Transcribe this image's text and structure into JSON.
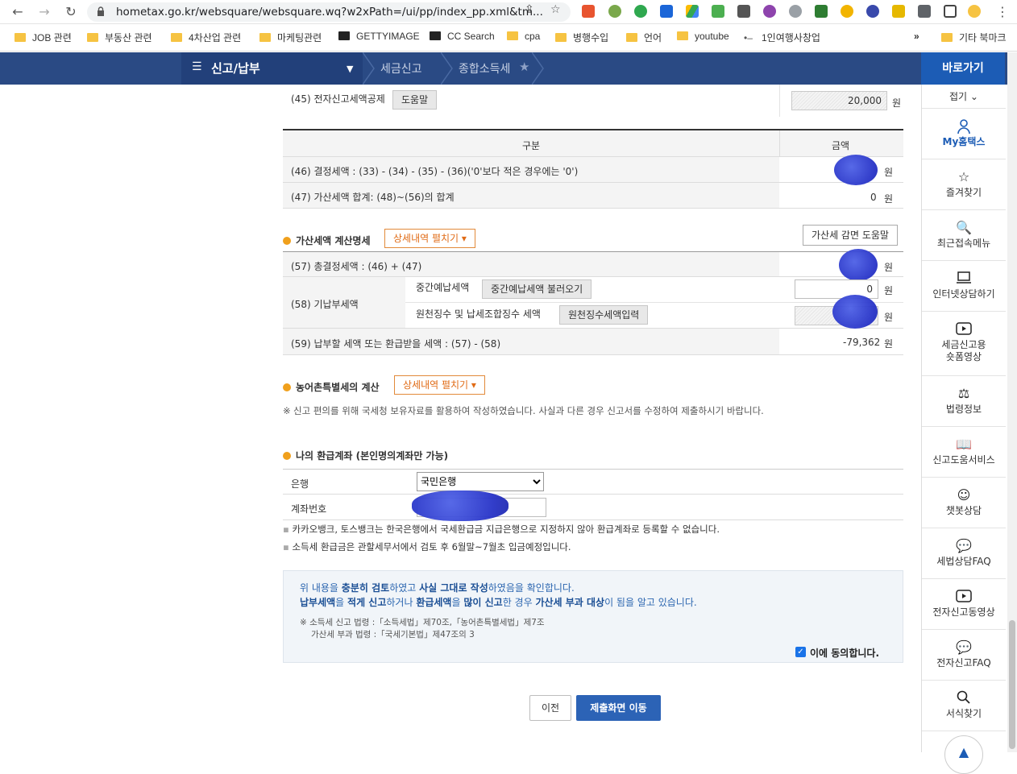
{
  "browser": {
    "url": "hometax.go.kr/websquare/websquare.wq?w2xPath=/ui/pp/index_pp.xml&tm...",
    "bookmarks": [
      "JOB 관련",
      "부동산 관련",
      "4차산업 관련",
      "마케팅관련",
      "GETTYIMAGE",
      "CC Search",
      "cpa",
      "병행수입",
      "언어",
      "youtube",
      "1인여행사창업"
    ],
    "other_bookmarks": "기타 북마크"
  },
  "topnav": {
    "menu": "신고/납부",
    "crumbs": [
      "세금신고",
      "종합소득세"
    ],
    "quick_title": "바로가기"
  },
  "row45": {
    "label": "(45) 전자신고세액공제",
    "help": "도움말",
    "value": "20,000",
    "unit": "원"
  },
  "table1": {
    "head_col1": "구분",
    "head_col2": "금액",
    "row46": {
      "label": "(46) 결정세액 : (33) - (34) - (35) - (36)('0'보다 적은 경우에는 '0')",
      "unit": "원"
    },
    "row47": {
      "label": "(47) 가산세액 합계: (48)~(56)의 합계",
      "value": "0",
      "unit": "원"
    }
  },
  "penalty": {
    "title": "가산세액 계산명세",
    "expand": "상세내역 펼치기 ▾",
    "help": "가산세 감면 도움말",
    "row57": {
      "label": "(57) 총결정세액 : (46) + (47)",
      "unit": "원"
    },
    "row58": {
      "label": "(58) 기납부세액",
      "sub1": "중간예납세액",
      "sub1_btn": "중간예납세액 불러오기",
      "sub1_value": "0",
      "sub2": "원천징수 및 납세조합징수 세액",
      "sub2_btn": "원천징수세액입력",
      "unit": "원"
    },
    "row59": {
      "label": "(59) 납부할 세액 또는 환급받을 세액 : (57) - (58)",
      "value": "-79,362",
      "unit": "원"
    }
  },
  "rural": {
    "title": "농어촌특별세의 계산",
    "expand": "상세내역 펼치기 ▾",
    "note_mark": "※",
    "note": "신고 편의를 위해 국세청 보유자료를 활용하여 작성하였습니다. 사실과 다른 경우 신고서를 수정하여 제출하시기 바랍니다."
  },
  "refund": {
    "title": "나의 환급계좌 (본인명의계좌만 가능)",
    "bank_label": "은행",
    "bank_value": "국민은행",
    "account_label": "계좌번호",
    "notes": [
      "카카오뱅크, 토스뱅크는 한국은행에서 국세환급금 지급은행으로 지정하지 않아 환급계좌로 등록할 수 없습니다.",
      "소득세 환급금은 관할세무서에서 검토 후 6월말~7월초 입금예정입니다."
    ]
  },
  "agree": {
    "line1_a": "위 내용을 ",
    "line1_b": "충분히 검토",
    "line1_c": "하였고 ",
    "line1_d": "사실 그대로 작성",
    "line1_e": "하였음을 확인합니다.",
    "line2_a": "납부세액",
    "line2_b": "을 ",
    "line2_c": "적게 신고",
    "line2_d": "하거나 ",
    "line2_e": "환급세액",
    "line2_f": "을 ",
    "line2_g": "많이 신고",
    "line2_h": "한 경우 ",
    "line2_i": "가산세 부과 대상",
    "line2_j": "이 됨을 알고 있습니다.",
    "law1": "※ 소득세 신고 법령 :「소득세법」제70조,「농어촌특별세법」제7조",
    "law2": "가산세 부과 법령 :「국세기본법」제47조의 3",
    "checkbox": "이에 동의합니다."
  },
  "buttons": {
    "prev": "이전",
    "next": "제출화면 이동"
  },
  "quick": {
    "collapse": "접기 ⌄",
    "items": [
      "My홈택스",
      "즐겨찾기",
      "최근접속메뉴",
      "인터넷상담하기",
      "세금신고용\n숏폼영상",
      "법령정보",
      "신고도움서비스",
      "챗봇상담",
      "세법상담FAQ",
      "전자신고동영상",
      "전자신고FAQ",
      "서식찾기"
    ]
  }
}
